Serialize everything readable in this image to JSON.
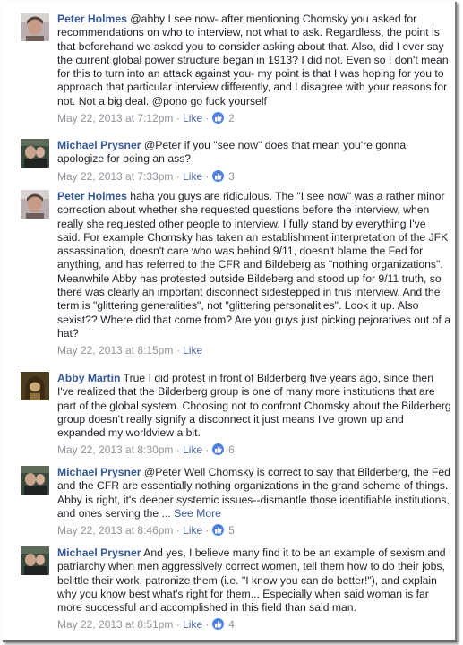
{
  "comments": [
    {
      "author": "Peter Holmes",
      "text": "@abby I see now- after mentioning Chomsky you asked for recommendations on who to interview, not what to ask. Regardless, the point is that beforehand we asked you to consider asking about that. Also, did I ever say the current global power structure began in 1913? I did not. Even so I don't mean for this to turn into an attack against you- my point is that I was hoping for you to approach that particular interview differently, and I disagree with your reasons for not. Not a big deal. @pono go fuck yourself",
      "timestamp": "May 22, 2013 at 7:12pm",
      "like_label": "Like",
      "likes": "2",
      "avatar": "peter-holmes-avatar"
    },
    {
      "author": "Michael Prysner",
      "text": "@Peter if you \"see now\" does that mean you're gonna apologize for being an ass?",
      "timestamp": "May 22, 2013 at 7:33pm",
      "like_label": "Like",
      "likes": "3",
      "avatar": "michael-prysner-avatar"
    },
    {
      "author": "Peter Holmes",
      "text": "haha you guys are ridiculous. The \"I see now\" was a rather minor correction about whether she requested questions before the interview, when really she requested other people to interview. I fully stand by everything I've said. For example Chomsky has taken an establishment interpretation of the JFK assassination, doesn't care who was behind 9/11, doesn't blame the Fed for anything, and has referred to the CFR and Bildeberg as \"nothing organizations\". Meanwhile Abby has protested outside Bildeberg and stood up for 9/11 truth, so there was clearly an important disconnect sidestepped in this interview. And the term is \"glittering generalities\", not \"glittering personalities\". Look it up. Also sexist?? Where did that come from? Are you guys just picking pejoratives out of a hat?",
      "timestamp": "May 22, 2013 at 8:15pm",
      "like_label": "Like",
      "likes": "",
      "avatar": "peter-holmes-avatar"
    },
    {
      "author": "Abby Martin",
      "text": "True I did protest in front of Bilderberg five years ago, since then I've realized that the Bilderberg group is one of many more institutions that are part of the global system. Choosing not to confront Chomsky about the Bilderberg group doesn't really signify a disconnect it just means I've grown up and expanded my worldview a bit.",
      "timestamp": "May 22, 2013 at 8:30pm",
      "like_label": "Like",
      "likes": "6",
      "avatar": "abby-martin-avatar"
    },
    {
      "author": "Michael Prysner",
      "text": "@Peter Well Chomsky is correct to say that Bilderberg, the Fed and the CFR are essentially nothing organizations in the grand scheme of things. Abby is right, it's deeper systemic issues--dismantle those identifiable institutions, and ones serving the ...",
      "see_more": "See More",
      "timestamp": "May 22, 2013 at 8:46pm",
      "like_label": "Like",
      "likes": "5",
      "avatar": "michael-prysner-avatar"
    },
    {
      "author": "Michael Prysner",
      "text": "And yes, I believe many find it to be an example of sexism and patriarchy when men aggressively correct women, tell them how to do their jobs, belittle their work, patronize them (i.e. \"I know you can do better!\"), and explain why you know best what's right for them... Especially when said woman is far more successful and accomplished in this field than said man.",
      "timestamp": "May 22, 2013 at 8:51pm",
      "like_label": "Like",
      "likes": "4",
      "avatar": "michael-prysner-avatar"
    }
  ],
  "separator": "·",
  "colors": {
    "author_link": "#365899",
    "meta_gray": "#90949c",
    "like_badge": "#4e82e6"
  }
}
